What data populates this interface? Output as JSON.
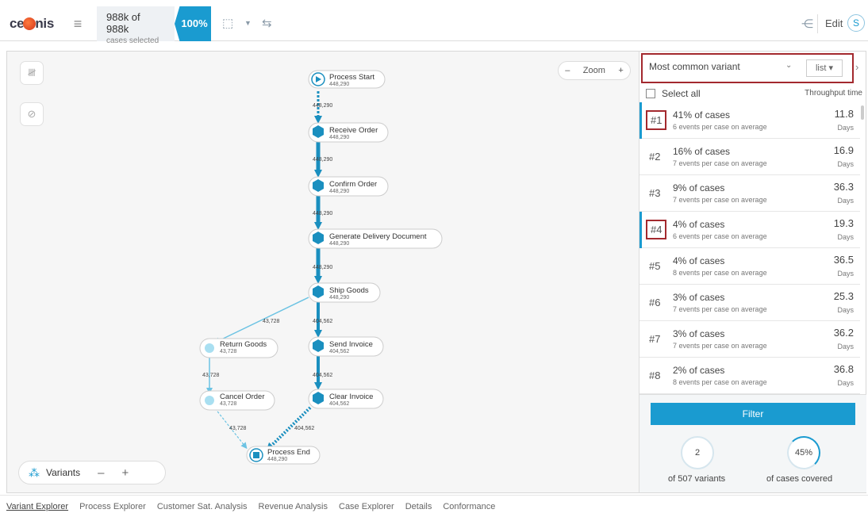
{
  "header": {
    "logo": "celonis",
    "cases_main": "988k of 988k",
    "cases_sub": "cases selected",
    "percent": "100%",
    "edit_label": "Edit",
    "avatar": "S"
  },
  "canvas": {
    "zoom_label": "Zoom",
    "zoom_minus": "–",
    "zoom_plus": "+",
    "variants_label": "Variants",
    "variants_minus": "–",
    "variants_plus": "+"
  },
  "graph": {
    "nodes": [
      {
        "label": "Process Start",
        "count": "448,290"
      },
      {
        "label": "Receive Order",
        "count": "448,290"
      },
      {
        "label": "Confirm Order",
        "count": "448,290"
      },
      {
        "label": "Generate Delivery Document",
        "count": "448,290"
      },
      {
        "label": "Ship Goods",
        "count": "448,290"
      },
      {
        "label": "Return Goods",
        "count": "43,728"
      },
      {
        "label": "Send Invoice",
        "count": "404,562"
      },
      {
        "label": "Cancel Order",
        "count": "43,728"
      },
      {
        "label": "Clear Invoice",
        "count": "404,562"
      },
      {
        "label": "Process End",
        "count": "448,290"
      }
    ],
    "edges": [
      "448,290",
      "448,290",
      "448,290",
      "448,290",
      "43,728",
      "404,562",
      "43,728",
      "404,562",
      "43,728",
      "404,562"
    ]
  },
  "panel": {
    "selector": "Most common variant",
    "list_label": "list",
    "select_all": "Select all",
    "throughput_header": "Throughput time",
    "filter_label": "Filter",
    "variants_count": "2",
    "variants_total": "of 507 variants",
    "cases_covered_pct": "45%",
    "cases_covered_label": "of cases covered",
    "rows": [
      {
        "rank": "#1",
        "pct": "41% of cases",
        "events": "6 events per case on average",
        "days": "11.8",
        "unit": "Days"
      },
      {
        "rank": "#2",
        "pct": "16% of cases",
        "events": "7 events per case on average",
        "days": "16.9",
        "unit": "Days"
      },
      {
        "rank": "#3",
        "pct": "9% of cases",
        "events": "7 events per case on average",
        "days": "36.3",
        "unit": "Days"
      },
      {
        "rank": "#4",
        "pct": "4% of cases",
        "events": "6 events per case on average",
        "days": "19.3",
        "unit": "Days"
      },
      {
        "rank": "#5",
        "pct": "4% of cases",
        "events": "8 events per case on average",
        "days": "36.5",
        "unit": "Days"
      },
      {
        "rank": "#6",
        "pct": "3% of cases",
        "events": "7 events per case on average",
        "days": "25.3",
        "unit": "Days"
      },
      {
        "rank": "#7",
        "pct": "3% of cases",
        "events": "7 events per case on average",
        "days": "36.2",
        "unit": "Days"
      },
      {
        "rank": "#8",
        "pct": "2% of cases",
        "events": "8 events per case on average",
        "days": "36.8",
        "unit": "Days"
      }
    ]
  },
  "tabs": [
    "Variant Explorer",
    "Process Explorer",
    "Customer Sat. Analysis",
    "Revenue Analysis",
    "Case Explorer",
    "Details",
    "Conformance"
  ]
}
